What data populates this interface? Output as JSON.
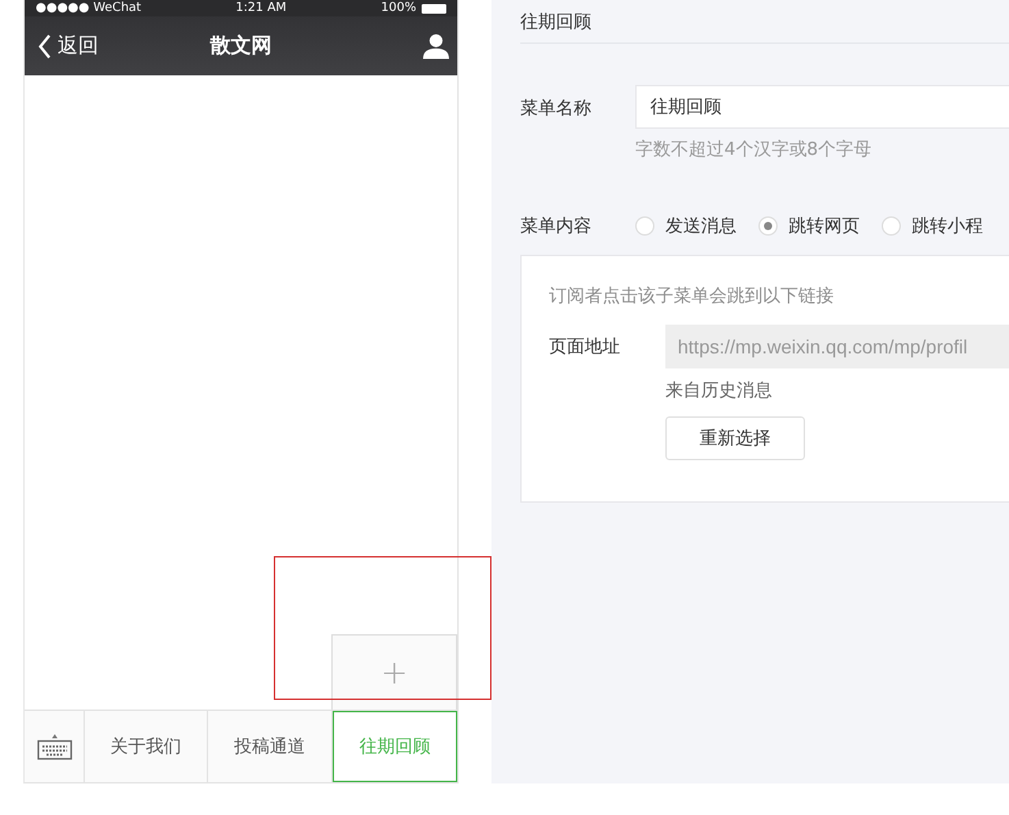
{
  "phone": {
    "status_bar": {
      "carrier": "●●●●● WeChat",
      "time": "1:21 AM",
      "battery": "100%"
    },
    "nav": {
      "back": "返回",
      "title": "散文网"
    },
    "menu": [
      {
        "label": "关于我们",
        "selected": false
      },
      {
        "label": "投稿通道",
        "selected": false
      },
      {
        "label": "往期回顾",
        "selected": true
      }
    ],
    "add_submenu": "+"
  },
  "editor": {
    "title": "往期回顾",
    "name_field": {
      "label": "菜单名称",
      "value": "往期回顾",
      "hint": "字数不超过4个汉字或8个字母"
    },
    "content": {
      "label": "菜单内容",
      "options": [
        {
          "label": "发送消息",
          "selected": false
        },
        {
          "label": "跳转网页",
          "selected": true
        },
        {
          "label": "跳转小程",
          "selected": false
        }
      ]
    },
    "link_box": {
      "note": "订阅者点击该子菜单会跳到以下链接",
      "url_label": "页面地址",
      "url": "https://mp.weixin.qq.com/mp/profil",
      "source": "来自历史消息",
      "button": "重新选择"
    }
  }
}
